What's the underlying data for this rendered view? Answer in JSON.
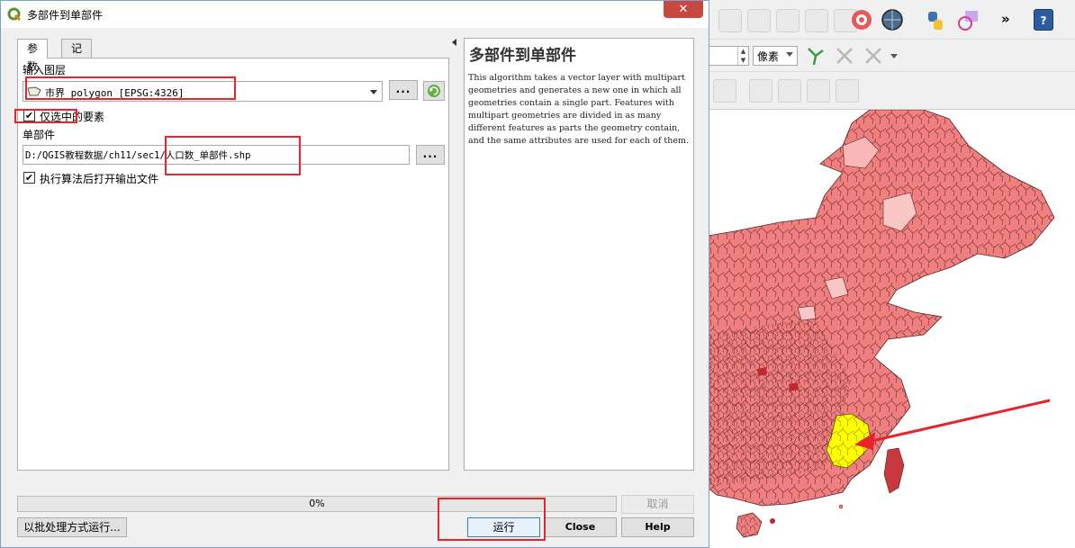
{
  "dialog": {
    "title": "多部件到单部件",
    "close_glyph": "✕",
    "tabs": [
      "参数",
      "记录"
    ],
    "input_layer_label": "输入图层",
    "input_layer_value": "市界_polygon [EPSG:4326]",
    "browse_label": "...",
    "selected_only_label": "仅选中的要素",
    "selected_only_checked": "✔",
    "output_label": "单部件",
    "output_path": "D:/QGIS教程数据/ch11/sec1/人口数_单部件.shp",
    "open_after_label": "执行算法后打开输出文件",
    "open_after_checked": "✔",
    "help_title": "多部件到单部件",
    "help_text": "This algorithm takes a vector layer with multipart geometries and generates a new one in which all geometries contain a single part. Features with multipart geometries are divided in as many different features as parts the geometry contain, and the same attributes are used for each of them.",
    "progress_text": "0%",
    "progress_value": 0,
    "buttons": {
      "cancel": "取消",
      "batch": "以批处理方式运行...",
      "run": "运行",
      "close": "Close",
      "help": "Help"
    }
  },
  "qgis": {
    "unit_select_value": "像素",
    "toolbar_more": "»",
    "help_icon_glyph": "?"
  },
  "colors": {
    "accent_border": "#3c7fb1",
    "annotation": "#e8242a",
    "map_fill": "#f08080",
    "highlight_fill": "#ffff00",
    "close_red": "#c7483e"
  }
}
